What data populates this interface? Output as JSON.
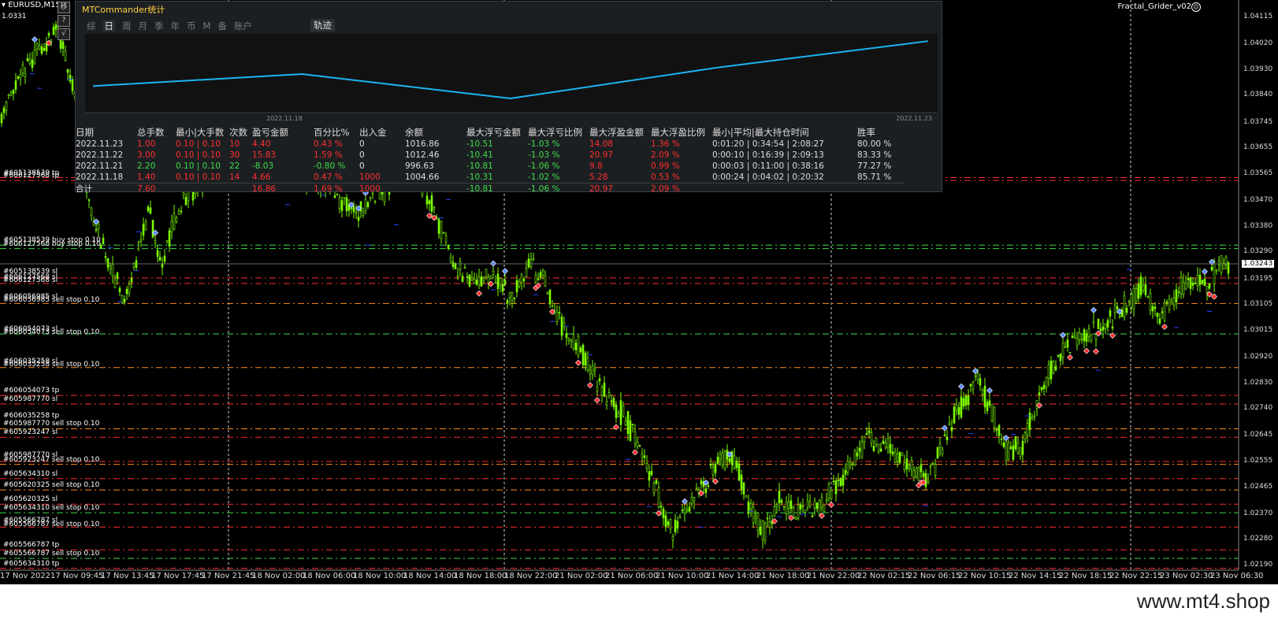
{
  "symbol": "EURUSD,M15",
  "top_price": "1.0331",
  "ea_name": "Fractal_Grider_v02",
  "side_buttons": [
    "移",
    "?",
    "√"
  ],
  "panel": {
    "title": "MTCommander统计",
    "tabs": [
      "综",
      "日",
      "周",
      "月",
      "季",
      "年",
      "币",
      "M",
      "备",
      "账户"
    ],
    "active_tab": "日",
    "track_tab": "轨迹",
    "equity_dates": [
      "2022.11.18",
      "2022.11.23"
    ],
    "equity_values": [
      1004.66,
      1012.46,
      996.63,
      1016.86,
      1033.86
    ],
    "columns": [
      "日期",
      "总手数",
      "最小|大手数",
      "次数",
      "盈亏金额",
      "百分比%",
      "出入金",
      "余额",
      "最大浮亏金额",
      "最大浮亏比例",
      "最大浮盈金额",
      "最大浮盈比例",
      "最小|平均|最大持仓时间",
      "胜率"
    ],
    "rows": [
      [
        "2022.11.23",
        "1.00",
        "0.10 | 0.10",
        "10",
        "4.40",
        "0.43 %",
        "0",
        "1016.86",
        "-10.51",
        "-1.03 %",
        "14.08",
        "1.36 %",
        "0:01:20 | 0:34:54 | 2:08:27",
        "80.00 %"
      ],
      [
        "2022.11.22",
        "3.00",
        "0.10 | 0.10",
        "30",
        "15.83",
        "1.59 %",
        "0",
        "1012.46",
        "-10.41",
        "-1.03 %",
        "20.97",
        "2.09 %",
        "0:00:10 | 0:16:39 | 2:09:13",
        "83.33 %"
      ],
      [
        "2022.11.21",
        "2.20",
        "0.10 | 0.10",
        "22",
        "-8.03",
        "-0.80 %",
        "0",
        "996.63",
        "-10.81",
        "-1.06 %",
        "9.8",
        "0.99 %",
        "0:00:03 | 0:11:00 | 0:38:16",
        "77.27 %"
      ],
      [
        "2022.11.18",
        "1.40",
        "0.10 | 0.10",
        "14",
        "4.66",
        "0.47 %",
        "1000",
        "1004.66",
        "-10.31",
        "-1.02 %",
        "5.28",
        "0.53 %",
        "0:00:24 | 0:04:02 | 0:20:32",
        "85.71 %"
      ]
    ],
    "row_colors": [
      [
        "w",
        "r",
        "r",
        "r",
        "r",
        "r",
        "w",
        "w",
        "g",
        "g",
        "r",
        "r",
        "w",
        "w"
      ],
      [
        "w",
        "r",
        "r",
        "r",
        "r",
        "r",
        "w",
        "w",
        "g",
        "g",
        "r",
        "r",
        "w",
        "w"
      ],
      [
        "w",
        "g",
        "g",
        "g",
        "g",
        "g",
        "w",
        "w",
        "g",
        "g",
        "r",
        "r",
        "w",
        "w"
      ],
      [
        "w",
        "r",
        "r",
        "r",
        "r",
        "r",
        "r",
        "w",
        "g",
        "g",
        "r",
        "r",
        "w",
        "w"
      ]
    ],
    "total": [
      "合计",
      "7.60",
      "",
      "",
      "16.86",
      "1.69 %",
      "1000",
      "",
      "-10.81",
      "-1.06 %",
      "20.97",
      "2.09 %",
      "",
      ""
    ],
    "total_colors": [
      "w",
      "r",
      "w",
      "w",
      "r",
      "r",
      "r",
      "w",
      "g",
      "g",
      "r",
      "r",
      "w",
      "w"
    ]
  },
  "price_ticks": [
    "1.04115",
    "1.04020",
    "1.03930",
    "1.03840",
    "1.03745",
    "1.03655",
    "1.03565",
    "1.03470",
    "1.03380",
    "1.03290",
    "1.03195",
    "1.03105",
    "1.03015",
    "1.02920",
    "1.02830",
    "1.02740",
    "1.02645",
    "1.02555",
    "1.02465",
    "1.02370",
    "1.02280",
    "1.02190"
  ],
  "current_price": "1.03243",
  "time_labels": [
    "17 Nov 2022",
    "17 Nov 09:45",
    "17 Nov 13:45",
    "17 Nov 17:45",
    "17 Nov 21:45",
    "18 Nov 02:00",
    "18 Nov 06:00",
    "18 Nov 10:00",
    "18 Nov 14:00",
    "18 Nov 18:00",
    "18 Nov 22:00",
    "21 Nov 02:00",
    "21 Nov 06:00",
    "21 Nov 10:00",
    "21 Nov 14:00",
    "21 Nov 18:00",
    "21 Nov 22:00",
    "22 Nov 02:15",
    "22 Nov 06:15",
    "22 Nov 10:15",
    "22 Nov 14:15",
    "22 Nov 18:15",
    "22 Nov 22:15",
    "23 Nov 02:30",
    "23 Nov 06:30"
  ],
  "order_labels": [
    {
      "text": "#605138539 tp",
      "price": 1.03552
    },
    {
      "text": "#606127568 tp",
      "price": 1.03542
    },
    {
      "text": "#605138539 buy stop 0.10",
      "price": 1.03315
    },
    {
      "text": "#606127568 buy stop 0.10",
      "price": 1.03303
    },
    {
      "text": "#605138539 sl",
      "price": 1.03205
    },
    {
      "text": "#606127568 sl",
      "price": 1.03187
    },
    {
      "text": "#606127568 sl",
      "price": 1.03175
    },
    {
      "text": "#606056985 sl",
      "price": 1.03117
    },
    {
      "text": "#606056985 sell stop 0.10",
      "price": 1.03105
    },
    {
      "text": "#606054073 sl",
      "price": 1.03003
    },
    {
      "text": "#606054073 sell stop 0.10",
      "price": 1.02993
    },
    {
      "text": "#606035258 sl",
      "price": 1.0289
    },
    {
      "text": "#606035258 sell stop 0.10",
      "price": 1.0288
    },
    {
      "text": "#606054073 tp",
      "price": 1.02787
    },
    {
      "text": "#605987770 sl",
      "price": 1.02757
    },
    {
      "text": "#606035258 tp",
      "price": 1.027
    },
    {
      "text": "#605987770 sell stop 0.10",
      "price": 1.0267
    },
    {
      "text": "#605923247 sl",
      "price": 1.0264
    },
    {
      "text": "#605987770 sl",
      "price": 1.0256
    },
    {
      "text": "#605923247 sell stop 0.10",
      "price": 1.02545
    },
    {
      "text": "#605634310 sl",
      "price": 1.02495
    },
    {
      "text": "#605620325 sell stop 0.10",
      "price": 1.02455
    },
    {
      "text": "#605620325 sl",
      "price": 1.02405
    },
    {
      "text": "#605634310 sell stop 0.10",
      "price": 1.02375
    },
    {
      "text": "#605566787 sl",
      "price": 1.0233
    },
    {
      "text": "#605566787 sell stop 0.10",
      "price": 1.02318
    },
    {
      "text": "#605566787 tp",
      "price": 1.02245
    },
    {
      "text": "#605566787 sell stop 0.10",
      "price": 1.02215
    },
    {
      "text": "#605634310 tp",
      "price": 1.0218
    }
  ],
  "level_lines": [
    {
      "price": 1.03552,
      "color": "#ff2e2e"
    },
    {
      "price": 1.03542,
      "color": "#ff2e2e"
    },
    {
      "price": 1.03315,
      "color": "#3ddc4a"
    },
    {
      "price": 1.03303,
      "color": "#3ddc4a"
    },
    {
      "price": 1.032,
      "color": "#ff2e2e"
    },
    {
      "price": 1.0318,
      "color": "#ff2e2e"
    },
    {
      "price": 1.0311,
      "color": "#ff8c1a"
    },
    {
      "price": 1.03003,
      "color": "#3ddc4a"
    },
    {
      "price": 1.02885,
      "color": "#ff8c1a"
    },
    {
      "price": 1.02787,
      "color": "#ff2e2e"
    },
    {
      "price": 1.02757,
      "color": "#ff2e2e"
    },
    {
      "price": 1.0267,
      "color": "#ff8c1a"
    },
    {
      "price": 1.0264,
      "color": "#ff2e2e"
    },
    {
      "price": 1.02555,
      "color": "#ff2e2e"
    },
    {
      "price": 1.02545,
      "color": "#ff8c1a"
    },
    {
      "price": 1.02495,
      "color": "#ff2e2e"
    },
    {
      "price": 1.02455,
      "color": "#ff8c1a"
    },
    {
      "price": 1.02405,
      "color": "#ff2e2e"
    },
    {
      "price": 1.02375,
      "color": "#3ddc4a"
    },
    {
      "price": 1.02325,
      "color": "#ff2e2e"
    },
    {
      "price": 1.02245,
      "color": "#ff2e2e"
    },
    {
      "price": 1.02215,
      "color": "#3ddc4a"
    },
    {
      "price": 1.0218,
      "color": "#ff2e2e"
    }
  ],
  "price_path": [
    [
      0,
      1.0376
    ],
    [
      30,
      1.0393
    ],
    [
      55,
      1.0402
    ],
    [
      75,
      1.0407
    ],
    [
      85,
      1.0394
    ],
    [
      95,
      1.0385
    ],
    [
      105,
      1.036
    ],
    [
      120,
      1.0338
    ],
    [
      140,
      1.0325
    ],
    [
      160,
      1.0312
    ],
    [
      175,
      1.033
    ],
    [
      190,
      1.0345
    ],
    [
      205,
      1.0322
    ],
    [
      220,
      1.034
    ],
    [
      240,
      1.035
    ],
    [
      270,
      1.0358
    ],
    [
      300,
      1.036
    ],
    [
      340,
      1.0362
    ],
    [
      380,
      1.0358
    ],
    [
      420,
      1.0352
    ],
    [
      450,
      1.0342
    ],
    [
      490,
      1.0352
    ],
    [
      530,
      1.0355
    ],
    [
      555,
      1.0342
    ],
    [
      575,
      1.0325
    ],
    [
      600,
      1.0318
    ],
    [
      625,
      1.032
    ],
    [
      650,
      1.0312
    ],
    [
      670,
      1.0325
    ],
    [
      690,
      1.032
    ],
    [
      710,
      1.0305
    ],
    [
      730,
      1.0298
    ],
    [
      750,
      1.0288
    ],
    [
      770,
      1.0278
    ],
    [
      790,
      1.0272
    ],
    [
      810,
      1.0262
    ],
    [
      830,
      1.0248
    ],
    [
      850,
      1.023
    ],
    [
      870,
      1.0238
    ],
    [
      890,
      1.0245
    ],
    [
      910,
      1.0255
    ],
    [
      930,
      1.0258
    ],
    [
      950,
      1.024
    ],
    [
      970,
      1.023
    ],
    [
      990,
      1.0243
    ],
    [
      1010,
      1.0238
    ],
    [
      1040,
      1.024
    ],
    [
      1070,
      1.025
    ],
    [
      1100,
      1.0262
    ],
    [
      1130,
      1.026
    ],
    [
      1160,
      1.0252
    ],
    [
      1180,
      1.025
    ],
    [
      1200,
      1.0265
    ],
    [
      1220,
      1.0275
    ],
    [
      1240,
      1.0285
    ],
    [
      1260,
      1.0272
    ],
    [
      1280,
      1.0258
    ],
    [
      1300,
      1.0262
    ],
    [
      1320,
      1.028
    ],
    [
      1340,
      1.029
    ],
    [
      1370,
      1.03
    ],
    [
      1400,
      1.0302
    ],
    [
      1430,
      1.031
    ],
    [
      1450,
      1.0318
    ],
    [
      1470,
      1.0305
    ],
    [
      1490,
      1.0312
    ],
    [
      1510,
      1.032
    ],
    [
      1530,
      1.0318
    ],
    [
      1550,
      1.0326
    ],
    [
      1560,
      1.0324
    ]
  ],
  "colors": {
    "candle": "#7cfc00",
    "equity_line": "#1eb4f0",
    "sep": "#ffffff",
    "grid": "#555555"
  },
  "watermark": "www.mt4.shop"
}
